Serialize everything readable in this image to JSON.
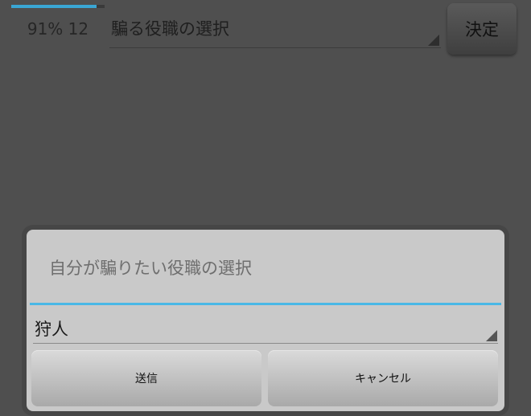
{
  "status": {
    "text": "91% 12",
    "progress_percent": 91,
    "accent_color": "#3aa6d4"
  },
  "top_spinner": {
    "value": "騙る役職の選択"
  },
  "decide_button": {
    "label": "決定"
  },
  "dialog": {
    "title": "自分が騙りたい役職の選択",
    "divider_color": "#49b8e6",
    "spinner_value": "狩人",
    "buttons": {
      "send_label": "送信",
      "cancel_label": "キャンセル"
    }
  },
  "icons": {
    "spinner_indicator": "dropdown-triangle-icon"
  }
}
